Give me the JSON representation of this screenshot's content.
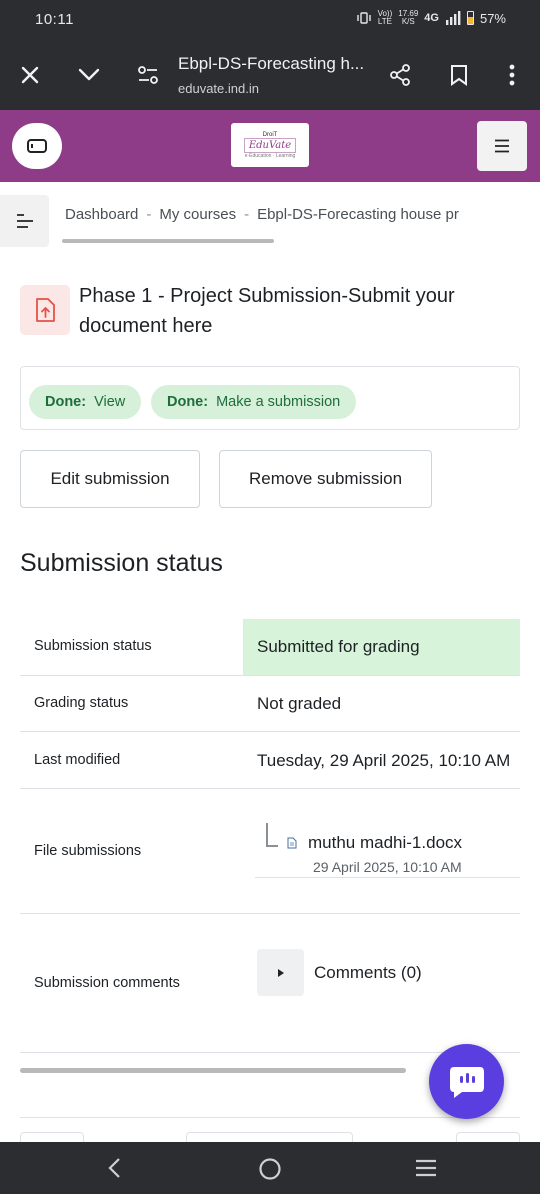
{
  "status_bar": {
    "time": "10:11",
    "net_speed_top": "17.69",
    "net_speed_bottom": "K/S",
    "volte": "Vo))",
    "lte": "LTE",
    "network": "4G",
    "battery": "57%"
  },
  "browser": {
    "title": "Ebpl-DS-Forecasting h...",
    "url": "eduvate.ind.in"
  },
  "site": {
    "logo_top": "DroiT",
    "logo_brand": "EduVate",
    "logo_small": "e·Education · Learning"
  },
  "breadcrumb": {
    "items": [
      "Dashboard",
      "My courses",
      "Ebpl-DS-Forecasting house pr"
    ],
    "separator": "-"
  },
  "activity": {
    "title": "Phase 1 - Project Submission-Submit your document here",
    "completion": [
      {
        "status": "Done:",
        "label": "View"
      },
      {
        "status": "Done:",
        "label": "Make a submission"
      }
    ],
    "buttons": {
      "edit": "Edit submission",
      "remove": "Remove submission"
    }
  },
  "submission": {
    "heading": "Submission status",
    "rows": {
      "status": {
        "label": "Submission status",
        "value": "Submitted for grading"
      },
      "grading": {
        "label": "Grading status",
        "value": "Not graded"
      },
      "modified": {
        "label": "Last modified",
        "value": "Tuesday, 29 April 2025, 10:10 AM"
      },
      "files": {
        "label": "File submissions"
      },
      "comments": {
        "label": "Submission comments",
        "value": "Comments (0)"
      }
    },
    "file": {
      "name": "muthu madhi-1.docx",
      "date": "29 April 2025, 10:10 AM"
    }
  },
  "colors": {
    "header_purple": "#8e3c88",
    "submitted_green": "#d7f3d9",
    "done_pill": "#d6f0d9",
    "chat_fab": "#5b3ee0",
    "system_bar": "#2b2d30"
  }
}
